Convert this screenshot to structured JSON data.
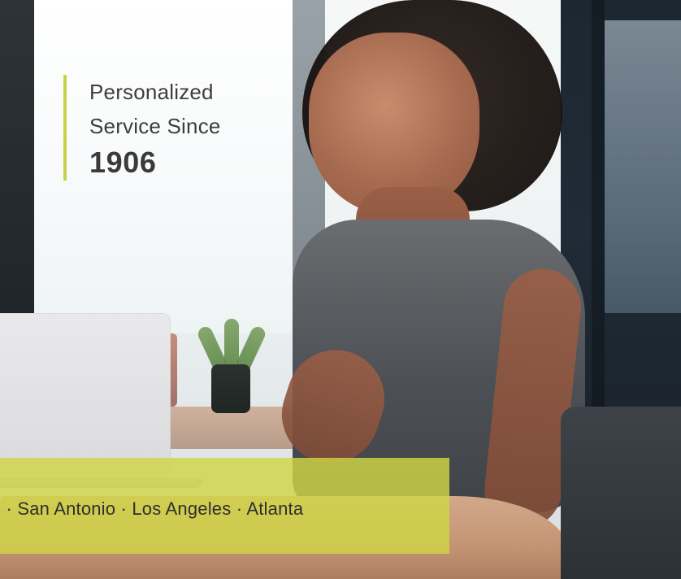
{
  "hero": {
    "tagline": {
      "line1": "Personalized",
      "line2": "Service Since",
      "year": "1906"
    },
    "locations": {
      "text": "s · San Antonio · Los Angeles · Atlanta"
    }
  },
  "colors": {
    "accent": "#cfd646",
    "text": "#3a3a3a"
  }
}
